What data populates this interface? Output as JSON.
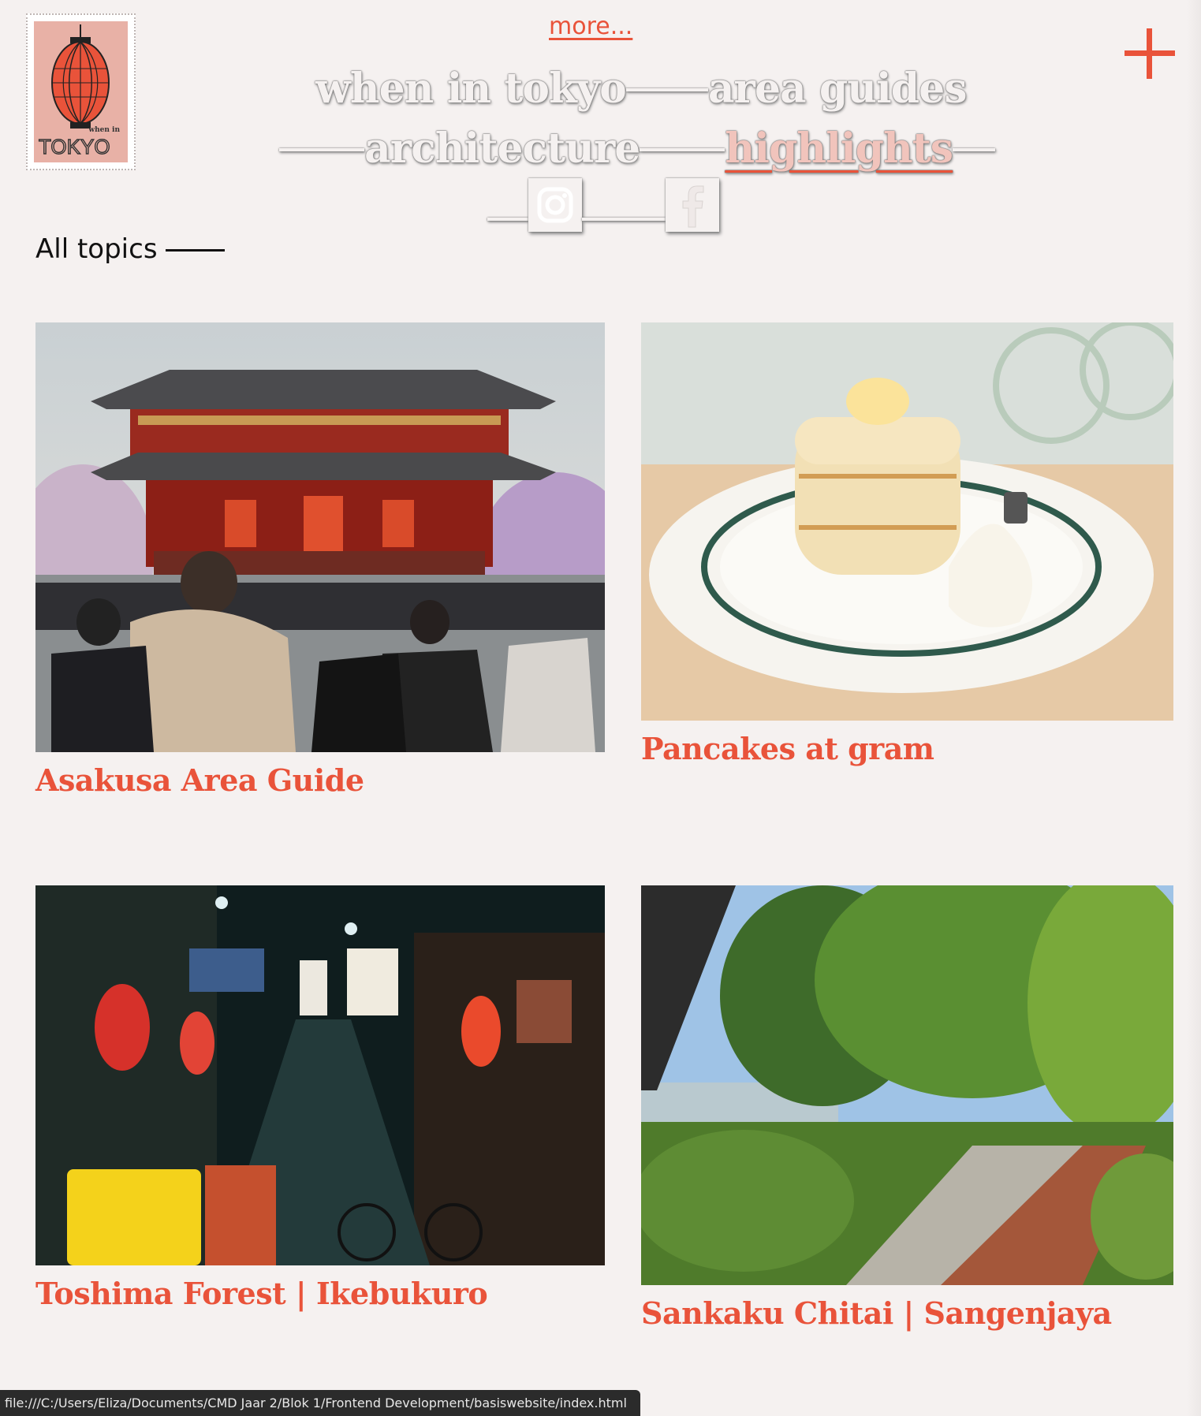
{
  "header": {
    "more_label": "more...",
    "logo": {
      "small_text": "when in",
      "main_text": "TOKYO"
    },
    "nav": [
      {
        "label": "when in tokyo",
        "active": false
      },
      {
        "label": "area guides",
        "active": false
      },
      {
        "label": "architecture",
        "active": false
      },
      {
        "label": "highlights",
        "active": true
      }
    ],
    "social": [
      "instagram-icon",
      "facebook-icon"
    ],
    "plus_icon": "plus-icon"
  },
  "filter": {
    "label": "All topics"
  },
  "articles": [
    {
      "title": "Asakusa Area Guide",
      "image": "Senso-ji temple gate with crowds and cherry blossoms"
    },
    {
      "title": "Pancakes at gram",
      "image": "stack of fluffy souffle pancakes on a plate"
    },
    {
      "title": "Toshima Forest | Ikebukuro",
      "image": "narrow alley with lanterns at night"
    },
    {
      "title": "Sankaku Chitai | Sangenjaya",
      "image": "rooftop garden path with trees"
    }
  ],
  "status_bar": {
    "url": "file:///C:/Users/Eliza/Documents/CMD Jaar 2/Blok 1/Frontend Development/basiswebsite/index.html"
  },
  "colors": {
    "accent": "#e9533a",
    "background": "#f5f1f0",
    "nav_active": "#f1c4bc"
  }
}
